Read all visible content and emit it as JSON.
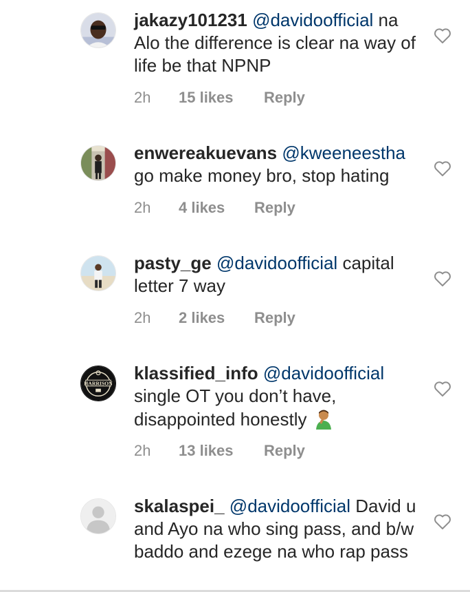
{
  "comments": [
    {
      "username": "jakazy101231",
      "mention": "@davidoofficial",
      "text": "na Alo the difference is clear na way of life be that NPNP",
      "time": "2h",
      "likes": "15 likes",
      "reply": "Reply"
    },
    {
      "username": "enwereakuevans",
      "mention": "@kweeneestha",
      "text": "go make money bro, stop hating",
      "time": "2h",
      "likes": "4 likes",
      "reply": "Reply"
    },
    {
      "username": "pasty_ge",
      "mention": "@davidoofficial",
      "text": "capital letter 7  way",
      "time": "2h",
      "likes": "2 likes",
      "reply": "Reply"
    },
    {
      "username": "klassified_info",
      "mention": "@davidoofficial",
      "text": "single OT you don’t have, disappointed honestly",
      "emoji": "man-facepalming-emoji",
      "time": "2h",
      "likes": "13 likes",
      "reply": "Reply"
    },
    {
      "username": "skalaspei_",
      "mention": "@davidoofficial",
      "text": "David u and Ayo na who sing pass, and b/w baddo and ezege na who rap pass"
    }
  ],
  "avatar_logo_text": "HARRISON",
  "colors": {
    "mention": "#00376b",
    "meta": "#8e8e8e",
    "text": "#262626"
  }
}
